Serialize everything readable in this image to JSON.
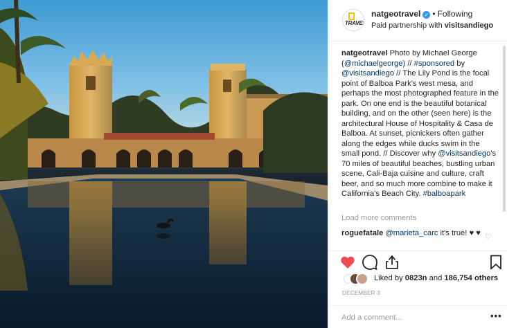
{
  "post": {
    "username": "natgeotravel",
    "verified_icon": "verified-badge-icon",
    "separator": "•",
    "follow_state": "Following",
    "partnership_prefix": "Paid partnership with",
    "partner": "visitsandiego",
    "avatar_text": "TRAVEL",
    "photo_alt": "Photo by Michael George — Lily Pond at Balboa Park"
  },
  "caption": {
    "user": "natgeotravel",
    "p1": " Photo by Michael George (",
    "mention1": "@michaelgeorge",
    "p2": ") // ",
    "hashtag1": "#sponsored",
    "p3": " by ",
    "mention2": "@visitsandiego",
    "p4": " // The Lily Pond is the focal point of Balboa Park's west mesa, and perhaps the most photographed feature in the park. On one end is the beautiful botanical building, and on the other (seen here) is the architectural House of Hospitality & Casa de Balboa. At sunset, picnickers often gather along the edges while ducks swim in the small pond. // Discover why ",
    "mention3": "@visitsandiego",
    "p5": "'s 70 miles of beautiful beaches, bustling urban scene, Cali-Baja cuisine and culture, craft beer, and so much more combine to make it California's Beach City. ",
    "hashtag2": "#balboapark"
  },
  "comments": {
    "load_more": "Load more comments",
    "items": [
      {
        "user": "roguefatale",
        "mention": "@marieta_carc",
        "text": " it's true! ♥ ♥"
      }
    ],
    "like_icon": "heart-outline-icon"
  },
  "actions": {
    "like_icon": "heart-filled-icon",
    "comment_icon": "comment-bubble-icon",
    "share_icon": "share-icon",
    "save_icon": "bookmark-icon",
    "like_color": "#ed4956"
  },
  "likes": {
    "prefix": "Liked by ",
    "first_user": "0823n",
    "middle": " and ",
    "count": "186,754 others"
  },
  "date": "DECEMBER 3",
  "add_comment": {
    "placeholder": "Add a comment...",
    "more_icon": "more-options-icon",
    "more_glyph": "•••"
  }
}
